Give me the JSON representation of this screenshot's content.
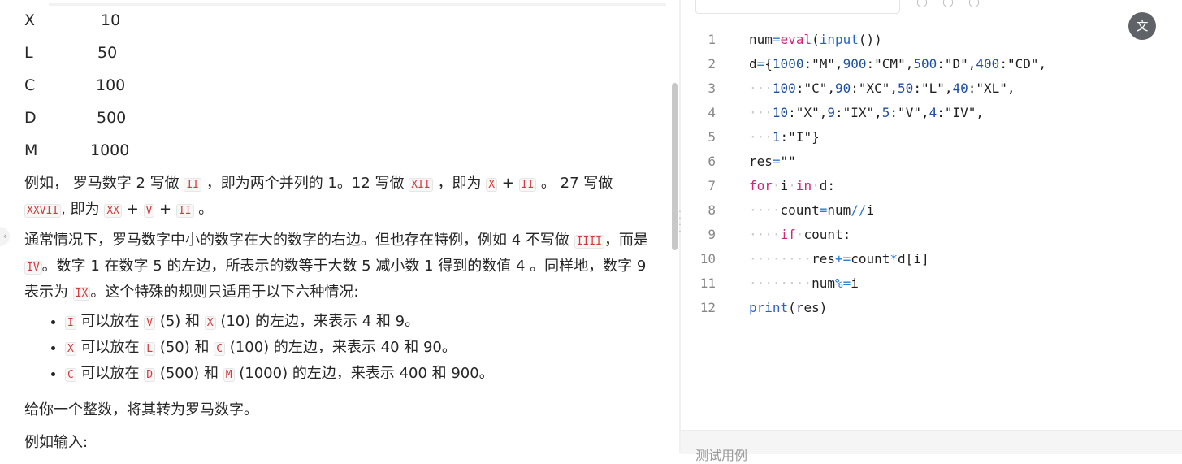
{
  "problem": {
    "symbols": [
      {
        "symbol": "X",
        "value": "10"
      },
      {
        "symbol": "L",
        "value": "50"
      },
      {
        "symbol": "C",
        "value": "100"
      },
      {
        "symbol": "D",
        "value": "500"
      },
      {
        "symbol": "M",
        "value": "1000"
      }
    ],
    "para1": {
      "t1": "例如， 罗马数字 2 写做 ",
      "c1": "II",
      "t2": " ，即为两个并列的 1。12 写做 ",
      "c2": "XII",
      "t3": " ，即为 ",
      "c3": "X",
      "t4": " + ",
      "c4": "II",
      "t5": " 。 27 写做  ",
      "c5": "XXVII",
      "t6": ", 即为 ",
      "c6": "XX",
      "t7": " + ",
      "c7": "V",
      "t8": " + ",
      "c8": "II",
      "t9": " 。"
    },
    "para2": {
      "t1": "通常情况下，罗马数字中小的数字在大的数字的右边。但也存在特例，例如 4 不写做 ",
      "c1": "IIII",
      "t2": "，而是 ",
      "c2": "IV",
      "t3": "。数字 1 在数字 5 的左边，所表示的数等于大数 5 减小数 1 得到的数值 4 。同样地，数字 9 表示为 ",
      "c3": "IX",
      "t4": "。这个特殊的规则只适用于以下六种情况:"
    },
    "rules": [
      {
        "c1": "I",
        "t1": " 可以放在 ",
        "c2": "V",
        "t2": " (5) 和 ",
        "c3": "X",
        "t3": " (10) 的左边，来表示 4 和 9。"
      },
      {
        "c1": "X",
        "t1": " 可以放在 ",
        "c2": "L",
        "t2": " (50) 和 ",
        "c3": "C",
        "t3": " (100) 的左边，来表示 40 和 90。"
      },
      {
        "c1": "C",
        "t1": " 可以放在 ",
        "c2": "D",
        "t2": " (500) 和 ",
        "c3": "M",
        "t3": " (1000) 的左边，来表示 400 和 900。"
      }
    ],
    "task": "给你一个整数，将其转为罗马数字。",
    "example_label": "例如输入:"
  },
  "editor": {
    "line_numbers": [
      "1",
      "2",
      "3",
      "4",
      "5",
      "6",
      "7",
      "8",
      "9",
      "10",
      "11",
      "12"
    ],
    "translate_icon": "translate-icon",
    "translate_glyph": "文"
  },
  "bottom_panel": {
    "label": "测试用例"
  },
  "colors": {
    "keyword": "#d4237a",
    "builtin": "#2266cc",
    "number": "#1d4ea8",
    "link_code": "#d63b3b"
  }
}
